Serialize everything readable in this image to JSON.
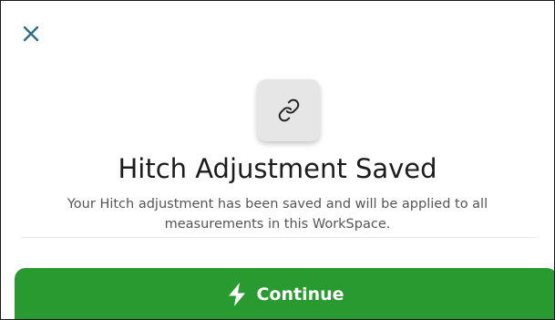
{
  "dialog": {
    "close_icon": "close-icon",
    "tile_icon": "link-icon",
    "title": "Hitch Adjustment Saved",
    "message": "Your Hitch adjustment has been saved and will be applied to all measurements in this WorkSpace.",
    "continue_label": "Continue",
    "continue_icon": "lightning-bolt-icon"
  },
  "colors": {
    "accent_teal": "#2b6f86",
    "button_green": "#299a30",
    "tile_gray": "#e6e6e6"
  }
}
